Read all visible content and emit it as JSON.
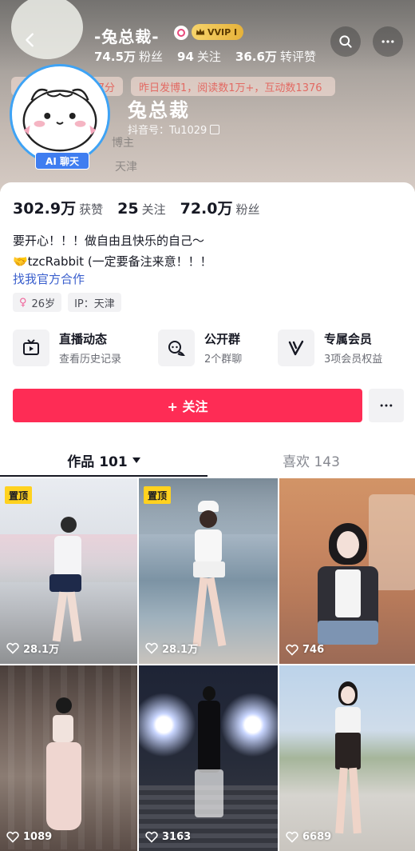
{
  "header": {
    "nickname_small": "-兔总裁-",
    "vip_label": "VVIP I",
    "followers_small": "74.5万",
    "followers_small_label": "粉丝",
    "following_small": "94",
    "following_small_label": "关注",
    "reposts_small": "36.6万",
    "reposts_small_label": "转评赞",
    "ghost_pill_left": "27分",
    "ghost_pill_right": "昨日发博1，阅读数1万+，互动数1376",
    "ghost_line_1": "博主",
    "ghost_line_2": "天津",
    "nickname": "兔总裁",
    "douyin_id": "抖音号：Tu1029",
    "ai_chat": "AI 聊天"
  },
  "profile": {
    "likes_value": "302.9万",
    "likes_label": "获赞",
    "following_value": "25",
    "following_label": "关注",
    "followers_value": "72.0万",
    "followers_label": "粉丝",
    "bio_line_1": "要开心！！！做自由且快乐的自己～",
    "bio_line_2": "🤝tzcRabbit (一定要备注来意！！！",
    "bio_link": "找我官方合作",
    "age_tag": "26岁",
    "ip_tag": "IP：天津"
  },
  "features": [
    {
      "title": "直播动态",
      "sub": "查看历史记录",
      "icon": "tv-icon"
    },
    {
      "title": "公开群",
      "sub": "2个群聊",
      "icon": "chat-group-icon"
    },
    {
      "title": "专属会员",
      "sub": "3项会员权益",
      "icon": "v-member-icon"
    }
  ],
  "actions": {
    "follow": "+ 关注"
  },
  "tabs": {
    "works": "作品 101",
    "likes": "喜欢 143"
  },
  "videos": [
    {
      "pinned": "置顶",
      "likes": "28.1万"
    },
    {
      "pinned": "置顶",
      "likes": "28.1万"
    },
    {
      "pinned": "",
      "likes": "746"
    },
    {
      "pinned": "",
      "likes": "1089"
    },
    {
      "pinned": "",
      "likes": "3163"
    },
    {
      "pinned": "",
      "likes": "6689"
    }
  ],
  "colors": {
    "brand_red": "#fe2c55",
    "link_blue": "#3a5fcd",
    "pin_yellow": "#ffd21f",
    "ai_blue": "#3f7df0"
  }
}
